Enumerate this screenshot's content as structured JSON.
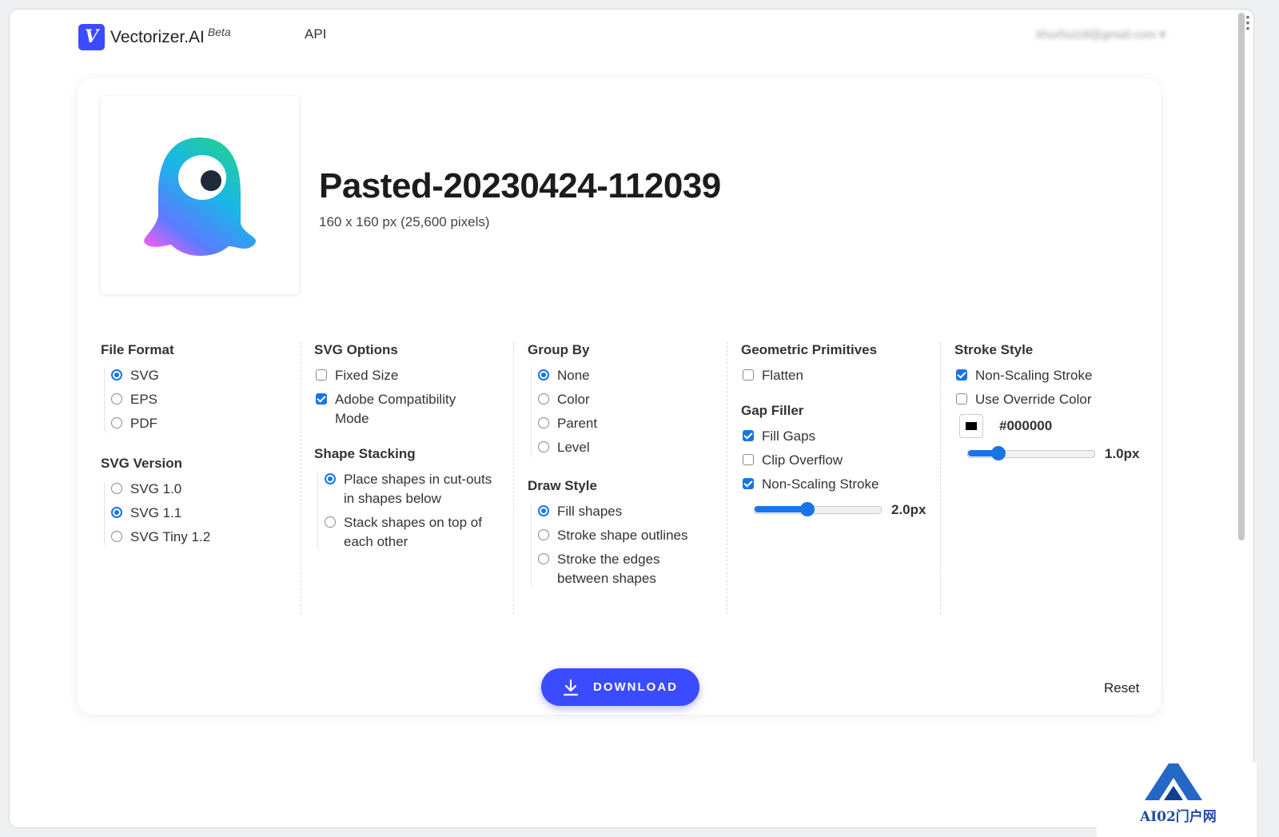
{
  "header": {
    "brand": "Vectorizer.AI",
    "beta": "Beta",
    "logo_letter": "V",
    "nav_api": "API",
    "account": "khurhui18@gmail.com ▾"
  },
  "file": {
    "name": "Pasted-20230424-112039",
    "dimensions": "160 x 160 px (25,600 pixels)"
  },
  "options": {
    "file_format": {
      "title": "File Format",
      "items": [
        "SVG",
        "EPS",
        "PDF"
      ],
      "selected": "SVG"
    },
    "svg_version": {
      "title": "SVG Version",
      "items": [
        "SVG 1.0",
        "SVG 1.1",
        "SVG Tiny 1.2"
      ],
      "selected": "SVG 1.1"
    },
    "svg_options": {
      "title": "SVG Options",
      "fixed_size": "Fixed Size",
      "adobe_line1": "Adobe Compatibility",
      "adobe_line2": "Mode"
    },
    "shape_stacking": {
      "title": "Shape Stacking",
      "opt1_line1": "Place shapes in cut-outs",
      "opt1_line2": "in shapes below",
      "opt2_line1": "Stack shapes on top of",
      "opt2_line2": "each other"
    },
    "group_by": {
      "title": "Group By",
      "items": [
        "None",
        "Color",
        "Parent",
        "Level"
      ],
      "selected": "None"
    },
    "draw_style": {
      "title": "Draw Style",
      "opt1": "Fill shapes",
      "opt2": "Stroke shape outlines",
      "opt3_line1": "Stroke the edges",
      "opt3_line2": "between shapes"
    },
    "geometric_primitives": {
      "title": "Geometric Primitives",
      "flatten": "Flatten"
    },
    "gap_filler": {
      "title": "Gap Filler",
      "fill_gaps": "Fill Gaps",
      "clip_overflow": "Clip Overflow",
      "non_scaling": "Non-Scaling Stroke",
      "stroke_width": "2.0px",
      "stroke_level": 0.42
    },
    "stroke_style": {
      "title": "Stroke Style",
      "non_scaling": "Non-Scaling Stroke",
      "override": "Use Override Color",
      "color": "#000000",
      "stroke_width": "1.0px",
      "stroke_level": 0.24
    }
  },
  "actions": {
    "download": "DOWNLOAD",
    "reset": "Reset"
  },
  "watermark": "AI02门户网",
  "colors": {
    "accent": "#3b4bff",
    "control_blue": "#1a73e8"
  }
}
